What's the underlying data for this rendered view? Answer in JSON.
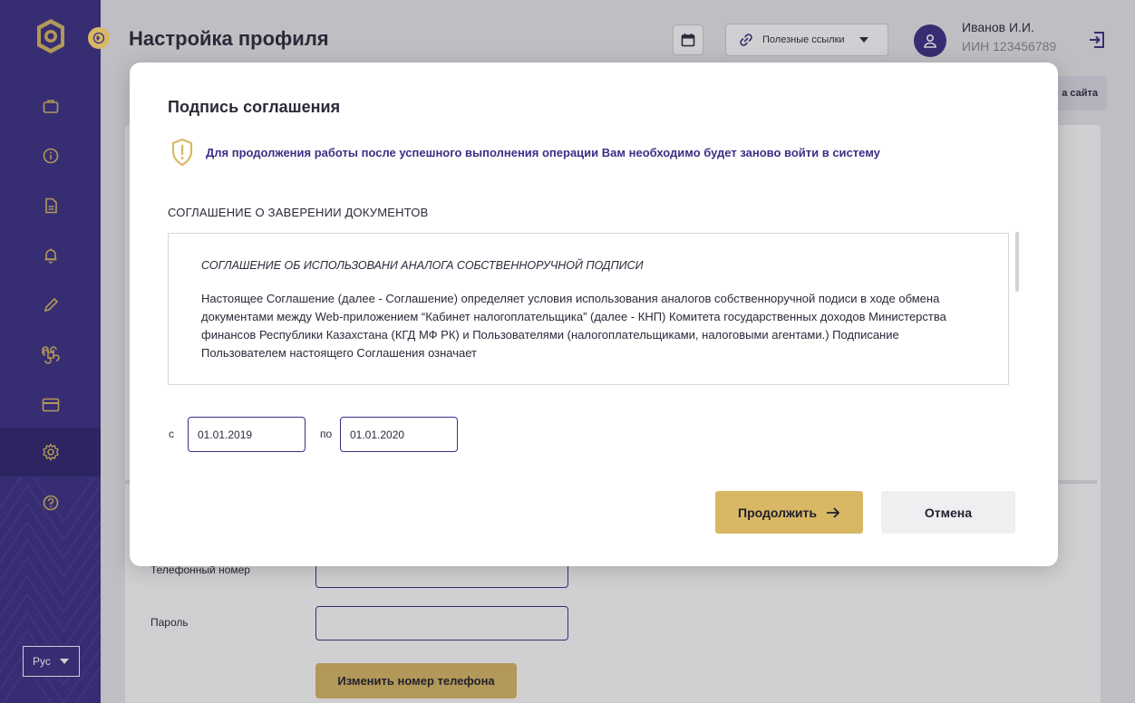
{
  "header": {
    "title": "Настройка профиля",
    "useful_links_label": "Полезные ссылки",
    "user_name": "Иванов И.И.",
    "user_iin": "ИИН 123456789",
    "site_map_label": "а сайта"
  },
  "sidebar": {
    "language": "Рус",
    "items": [
      {
        "icon": "briefcase-icon"
      },
      {
        "icon": "info-icon"
      },
      {
        "icon": "document-icon"
      },
      {
        "icon": "bell-icon"
      },
      {
        "icon": "pencil-icon"
      },
      {
        "icon": "command-icon"
      },
      {
        "icon": "card-icon"
      },
      {
        "icon": "gear-icon",
        "active": true
      },
      {
        "icon": "help-icon"
      }
    ]
  },
  "background_form": {
    "phone_label": "Телефонный номер",
    "password_label": "Пароль",
    "change_phone_button": "Изменить номер телефона"
  },
  "modal": {
    "title": "Подпись соглашения",
    "warning": "Для продолжения работы после успешного выполнения операции Вам необходимо будет заново войти в систему",
    "section_title": "СОГЛАШЕНИЕ О ЗАВЕРЕНИИ ДОКУМЕНТОВ",
    "doc_heading": "СОГЛАШЕНИЕ ОБ ИСПОЛЬЗОВАНИ АНАЛОГА СОБСТВЕННОРУЧНОЙ ПОДПИСИ",
    "doc_body": "Настоящее Соглашение (далее - Соглашение) определяет условия использования аналогов собственноручной подиси в ходе обмена документами между Web-приложением “Кабинет налогоплательщика” (далее - КНП) Комитета государственных доходов Министерства финансов Республики Казахстана (КГД МФ РК) и Пользователями (налогоплательщиками, налоговыми агентами.) Подписание Пользователем настоящего Соглашения означает",
    "from_label": "с",
    "from_value": "01.01.2019",
    "to_label": "по",
    "to_value": "01.01.2020",
    "continue_button": "Продолжить",
    "cancel_button": "Отмена"
  },
  "colors": {
    "primary": "#3b2f86",
    "accent": "#d9b865"
  }
}
